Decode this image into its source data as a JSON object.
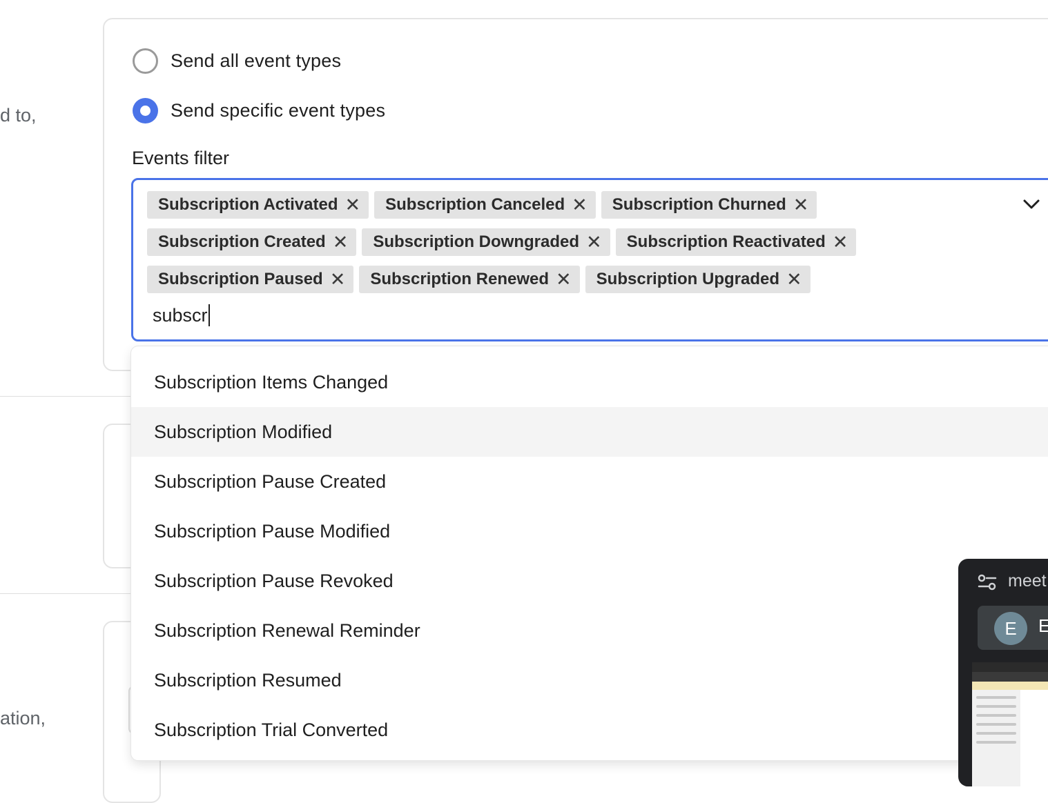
{
  "left_fragments": [
    "d to,",
    "ation,"
  ],
  "radios": [
    {
      "label": "Send all event types",
      "selected": false
    },
    {
      "label": "Send specific event types",
      "selected": true
    }
  ],
  "events_filter": {
    "label": "Events filter",
    "selected_chips": [
      [
        "Subscription Activated",
        "Subscription Canceled",
        "Subscription Churned"
      ],
      [
        "Subscription Created",
        "Subscription Downgraded",
        "Subscription Reactivated"
      ],
      [
        "Subscription Paused",
        "Subscription Renewed",
        "Subscription Upgraded"
      ]
    ],
    "remove_glyph": "✕",
    "search_value": "subscr",
    "dropdown_icon": "chevron-down-icon"
  },
  "dropdown_options": [
    "Subscription Items Changed",
    "Subscription Modified",
    "Subscription Pause Created",
    "Subscription Pause Modified",
    "Subscription Pause Revoked",
    "Subscription Renewal Reminder",
    "Subscription Resumed",
    "Subscription Trial Converted"
  ],
  "highlighted_option": "Subscription Modified",
  "meet_overlay": {
    "title": "meet",
    "avatar_initial": "E",
    "name": "E"
  },
  "colors": {
    "accent": "#4a73e8",
    "chip_bg": "#e3e3e3",
    "highlight_bg": "#f4f4f4",
    "overlay_bg": "#202124"
  }
}
